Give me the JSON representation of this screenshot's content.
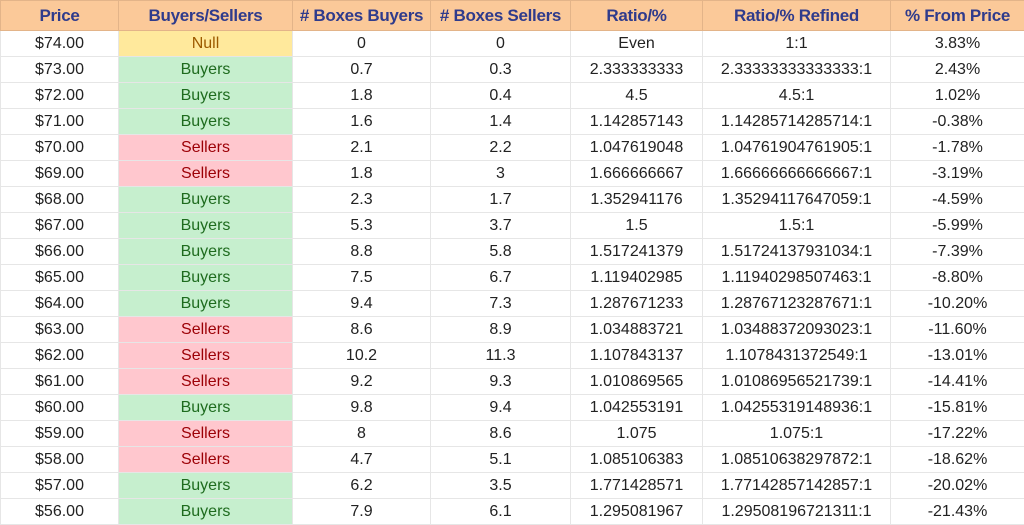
{
  "headers": [
    "Price",
    "Buyers/Sellers",
    "# Boxes Buyers",
    "# Boxes Sellers",
    "Ratio/%",
    "Ratio/% Refined",
    "% From Price"
  ],
  "status_colors": {
    "Buyers": {
      "bg": "#c6efce",
      "text": "#1e6b1e"
    },
    "Sellers": {
      "bg": "#ffc7ce",
      "text": "#9c0006"
    },
    "Null": {
      "bg": "#ffe99c",
      "text": "#9c5a00"
    }
  },
  "header_color": "#fbc999",
  "rows": [
    [
      "$74.00",
      "Null",
      "0",
      "0",
      "Even",
      "1:1",
      "3.83%"
    ],
    [
      "$73.00",
      "Buyers",
      "0.7",
      "0.3",
      "2.333333333",
      "2.33333333333333:1",
      "2.43%"
    ],
    [
      "$72.00",
      "Buyers",
      "1.8",
      "0.4",
      "4.5",
      "4.5:1",
      "1.02%"
    ],
    [
      "$71.00",
      "Buyers",
      "1.6",
      "1.4",
      "1.142857143",
      "1.14285714285714:1",
      "-0.38%"
    ],
    [
      "$70.00",
      "Sellers",
      "2.1",
      "2.2",
      "1.047619048",
      "1.04761904761905:1",
      "-1.78%"
    ],
    [
      "$69.00",
      "Sellers",
      "1.8",
      "3",
      "1.666666667",
      "1.66666666666667:1",
      "-3.19%"
    ],
    [
      "$68.00",
      "Buyers",
      "2.3",
      "1.7",
      "1.352941176",
      "1.35294117647059:1",
      "-4.59%"
    ],
    [
      "$67.00",
      "Buyers",
      "5.3",
      "3.7",
      "1.5",
      "1.5:1",
      "-5.99%"
    ],
    [
      "$66.00",
      "Buyers",
      "8.8",
      "5.8",
      "1.517241379",
      "1.51724137931034:1",
      "-7.39%"
    ],
    [
      "$65.00",
      "Buyers",
      "7.5",
      "6.7",
      "1.119402985",
      "1.11940298507463:1",
      "-8.80%"
    ],
    [
      "$64.00",
      "Buyers",
      "9.4",
      "7.3",
      "1.287671233",
      "1.28767123287671:1",
      "-10.20%"
    ],
    [
      "$63.00",
      "Sellers",
      "8.6",
      "8.9",
      "1.034883721",
      "1.03488372093023:1",
      "-11.60%"
    ],
    [
      "$62.00",
      "Sellers",
      "10.2",
      "11.3",
      "1.107843137",
      "1.1078431372549:1",
      "-13.01%"
    ],
    [
      "$61.00",
      "Sellers",
      "9.2",
      "9.3",
      "1.010869565",
      "1.01086956521739:1",
      "-14.41%"
    ],
    [
      "$60.00",
      "Buyers",
      "9.8",
      "9.4",
      "1.042553191",
      "1.04255319148936:1",
      "-15.81%"
    ],
    [
      "$59.00",
      "Sellers",
      "8",
      "8.6",
      "1.075",
      "1.075:1",
      "-17.22%"
    ],
    [
      "$58.00",
      "Sellers",
      "4.7",
      "5.1",
      "1.085106383",
      "1.08510638297872:1",
      "-18.62%"
    ],
    [
      "$57.00",
      "Buyers",
      "6.2",
      "3.5",
      "1.771428571",
      "1.77142857142857:1",
      "-20.02%"
    ],
    [
      "$56.00",
      "Buyers",
      "7.9",
      "6.1",
      "1.295081967",
      "1.29508196721311:1",
      "-21.43%"
    ]
  ]
}
